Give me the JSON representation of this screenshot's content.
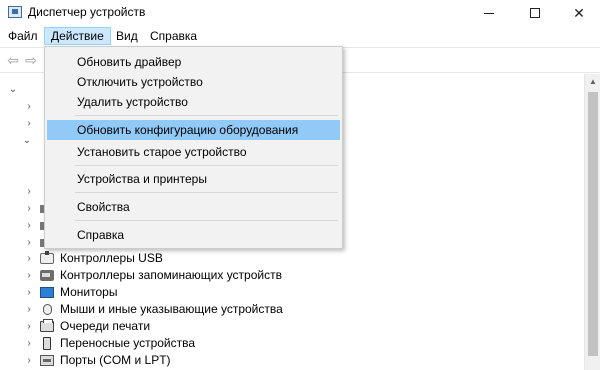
{
  "window": {
    "title": "Диспетчер устройств",
    "minimize_label": "—",
    "close_label": "✕"
  },
  "menubar": {
    "items": [
      {
        "label": "Файл"
      },
      {
        "label": "Действие"
      },
      {
        "label": "Вид"
      },
      {
        "label": "Справка"
      }
    ]
  },
  "toolbar": {
    "back_glyph": "⇦",
    "forward_glyph": "⇨"
  },
  "action_menu": {
    "items": [
      {
        "label": "Обновить драйвер"
      },
      {
        "label": "Отключить устройство"
      },
      {
        "label": "Удалить устройство"
      },
      {
        "label": "Обновить конфигурацию оборудования"
      },
      {
        "label": "Установить старое устройство"
      },
      {
        "label": "Устройства и принтеры"
      },
      {
        "label": "Свойства"
      },
      {
        "label": "Справка"
      }
    ],
    "highlighted": "Обновить конфигурацию оборудования"
  },
  "tree": {
    "expand_glyph": "›",
    "collapse_glyph": "⌄",
    "items": [
      {
        "label": "Контроллеры USB",
        "icon": "usb-icon"
      },
      {
        "label": "Контроллеры запоминающих устройств",
        "icon": "storage-controller-icon"
      },
      {
        "label": "Мониторы",
        "icon": "monitor-icon"
      },
      {
        "label": "Мыши и иные указывающие устройства",
        "icon": "mouse-icon"
      },
      {
        "label": "Очереди печати",
        "icon": "printer-icon"
      },
      {
        "label": "Переносные устройства",
        "icon": "portable-device-icon"
      },
      {
        "label": "Порты (COM и LPT)",
        "icon": "ports-icon"
      }
    ]
  },
  "scrollbar": {
    "up_glyph": "▲"
  },
  "colors": {
    "menu_highlight": "#91c9f7",
    "menubar_active": "#cce8ff"
  }
}
